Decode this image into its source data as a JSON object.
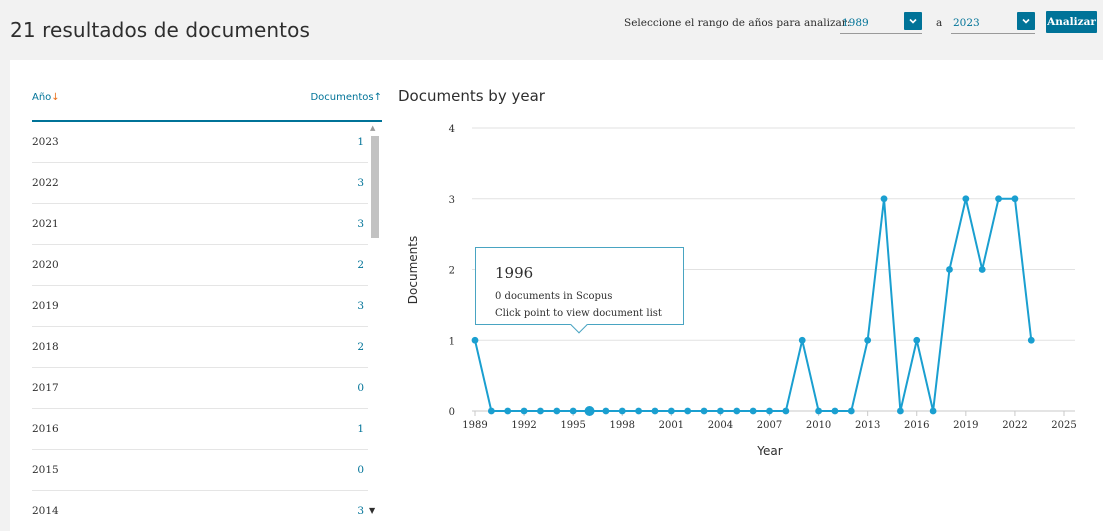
{
  "header": {
    "title": "21 resultados de documentos",
    "range_label": "Seleccione el rango de años para analizar:",
    "from_year": "1989",
    "separator": "a",
    "to_year": "2023",
    "analyze_label": "Analizar"
  },
  "table": {
    "col_year": "Año",
    "col_docs": "Documentos",
    "year_sort_icon": "arrow-down-icon",
    "docs_sort_icon": "arrow-up-icon",
    "rows": [
      {
        "year": "2023",
        "count": "1"
      },
      {
        "year": "2022",
        "count": "3"
      },
      {
        "year": "2021",
        "count": "3"
      },
      {
        "year": "2020",
        "count": "2"
      },
      {
        "year": "2019",
        "count": "3"
      },
      {
        "year": "2018",
        "count": "2"
      },
      {
        "year": "2017",
        "count": "0"
      },
      {
        "year": "2016",
        "count": "1"
      },
      {
        "year": "2015",
        "count": "0"
      },
      {
        "year": "2014",
        "count": "3"
      }
    ]
  },
  "colors": {
    "accent": "#007398",
    "line": "#1a9fd0",
    "sort_arrow": "#e9711c"
  },
  "tooltip": {
    "year": "1996",
    "line1": "0 documents in Scopus",
    "line2": "Click point to view document list"
  },
  "chart_data": {
    "type": "line",
    "title": "Documents by year",
    "xlabel": "Year",
    "ylabel": "Documents",
    "xlim": [
      1989,
      2025
    ],
    "ylim": [
      0,
      4
    ],
    "x_ticks": [
      1989,
      1992,
      1995,
      1998,
      2001,
      2004,
      2007,
      2010,
      2013,
      2016,
      2019,
      2022,
      2025
    ],
    "y_ticks": [
      0,
      1,
      2,
      3,
      4
    ],
    "grid": true,
    "highlighted_x": 1996,
    "x": [
      1989,
      1990,
      1991,
      1992,
      1993,
      1994,
      1995,
      1996,
      1997,
      1998,
      1999,
      2000,
      2001,
      2002,
      2003,
      2004,
      2005,
      2006,
      2007,
      2008,
      2009,
      2010,
      2011,
      2012,
      2013,
      2014,
      2015,
      2016,
      2017,
      2018,
      2019,
      2020,
      2021,
      2022,
      2023
    ],
    "series": [
      {
        "values": [
          1,
          0,
          0,
          0,
          0,
          0,
          0,
          0,
          0,
          0,
          0,
          0,
          0,
          0,
          0,
          0,
          0,
          0,
          0,
          0,
          1,
          0,
          0,
          0,
          1,
          3,
          0,
          1,
          0,
          2,
          3,
          2,
          3,
          3,
          1
        ]
      }
    ]
  }
}
